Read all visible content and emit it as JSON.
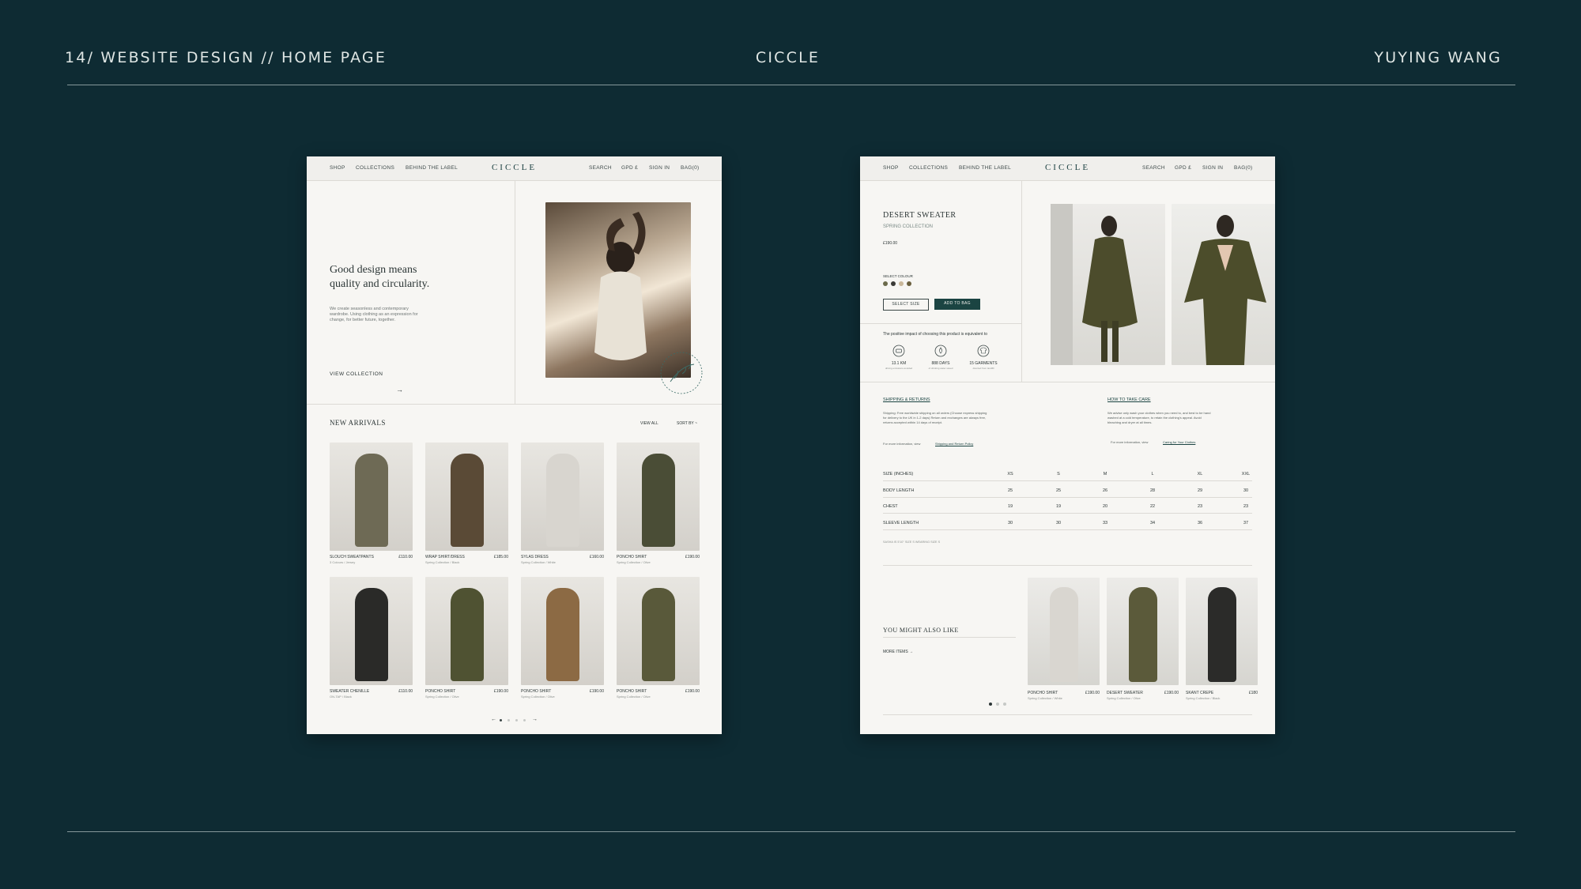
{
  "header": {
    "left": "14/ WEBSITE DESIGN // HOME PAGE",
    "center": "CICCLE",
    "right": "YUYING WANG"
  },
  "nav": {
    "shop": "SHOP",
    "collections": "COLLECTIONS",
    "behind": "BEHIND THE LABEL",
    "logo": "CICCLE",
    "search": "SEARCH",
    "currency": "GPD £",
    "signin": "SIGN IN",
    "bag": "BAG(0)"
  },
  "home": {
    "hero_title_1": "Good design means",
    "hero_title_2": "quality and circularity.",
    "hero_body_1": "We create seasonless and contemporary",
    "hero_body_2": "wardrobe. Using clothing as an expression for",
    "hero_body_3": "change, for better future, together.",
    "view_collection": "VIEW COLLECTION",
    "arrow": "→",
    "new_arrivals": "NEW ARRIVALS",
    "view_all": "VIEW ALL",
    "sort_by": "SORT BY ~",
    "products": [
      {
        "name": "SLOUCH SWEATPANTS",
        "price": "£110.00",
        "sub": "3 Colours / Jersey",
        "color": "#6e6a55"
      },
      {
        "name": "WRAP SHIRT/DRESS",
        "price": "£185.00",
        "sub": "Spring Collection / Black",
        "color": "#5a4a36"
      },
      {
        "name": "SYLAS DRESS",
        "price": "£160.00",
        "sub": "Spring Collection / White",
        "color": "#d8d5cf"
      },
      {
        "name": "PONCHO SHIRT",
        "price": "£190.00",
        "sub": "Spring Collection / Olive",
        "color": "#4a4d36"
      },
      {
        "name": "SWEATER CHENILLE",
        "price": "£110.00",
        "sub": "ON-TAP / Black",
        "color": "#2a2a28"
      },
      {
        "name": "PONCHO SHIRT",
        "price": "£190.00",
        "sub": "Spring Collection / Olive",
        "color": "#4f5232"
      },
      {
        "name": "PONCHO SHIRT",
        "price": "£190.00",
        "sub": "Spring Collection / Olive",
        "color": "#8c6a44"
      },
      {
        "name": "PONCHO SHIRT",
        "price": "£190.00",
        "sub": "Spring Collection / Olive",
        "color": "#59593a"
      }
    ],
    "pager_prev": "←",
    "pager_next": "→"
  },
  "product": {
    "name": "DESERT SWEATER",
    "collection": "SPRING COLLECTION",
    "price": "£190.00",
    "select_colour": "SELECT COLOUR",
    "swatches": [
      "#6b6a4a",
      "#3a3a36",
      "#c9b79a",
      "#6a5f3e"
    ],
    "select_size": "SELECT SIZE",
    "add_to_bag": "ADD TO BAG",
    "impact_title": "The positive impact of choosing this product is equivalent to",
    "impact": [
      {
        "value": "13.1 KM",
        "sub": "driving emissions avoided"
      },
      {
        "value": "888 DAYS",
        "sub": "of drinking water saved"
      },
      {
        "value": "15 GARMENTS",
        "sub": "diverted from landfill"
      }
    ],
    "shipping_title": "SHIPPING & RETURNS",
    "shipping_body_1": "Shipping: Free worldwide shipping on all orders (Choose express shipping",
    "shipping_body_2": "for delivery to the UK in 1-2 days) Return and exchanges are always free,",
    "shipping_body_3": "returns accepted within 14 days of receipt.",
    "shipping_more": "For more information, view",
    "shipping_link": "Shipping and Return Policy",
    "care_title": "HOW TO TAKE CARE",
    "care_body_1": "We advise only wash your clothes when you need to, and best to be hand",
    "care_body_2": "washed at a cold temperature, to retain the clothing's appeal. Avoid",
    "care_body_3": "bleaching and dryer at all times.",
    "care_more": "For more information, view",
    "care_link": "Caring for Your Clothes",
    "size_table": {
      "headers": [
        "SIZE (INCHES)",
        "XS",
        "S",
        "M",
        "L",
        "XL",
        "XXL"
      ],
      "rows": [
        [
          "BODY LENGTH",
          "25",
          "25",
          "26",
          "28",
          "29",
          "30"
        ],
        [
          "CHEST",
          "19",
          "19",
          "20",
          "22",
          "23",
          "23"
        ],
        [
          "SLEEVE LENGTH",
          "30",
          "30",
          "33",
          "34",
          "36",
          "37"
        ]
      ],
      "note": "SASHA IS 5'10\" SIZE S WEARING SIZE S"
    },
    "also_like": "YOU MIGHT ALSO LIKE",
    "more_items": "MORE ITEMS →",
    "related": [
      {
        "name": "PONCHO SHIRT",
        "price": "£190.00",
        "sub": "Spring Collection / White",
        "color": "#d9d6d0"
      },
      {
        "name": "DESERT SWEATER",
        "price": "£190.00",
        "sub": "Spring Collection / Olive",
        "color": "#5b5a3a"
      },
      {
        "name": "SKANT CREPE",
        "price": "£180",
        "sub": "Spring Collection / Black",
        "color": "#2b2b29"
      }
    ]
  }
}
